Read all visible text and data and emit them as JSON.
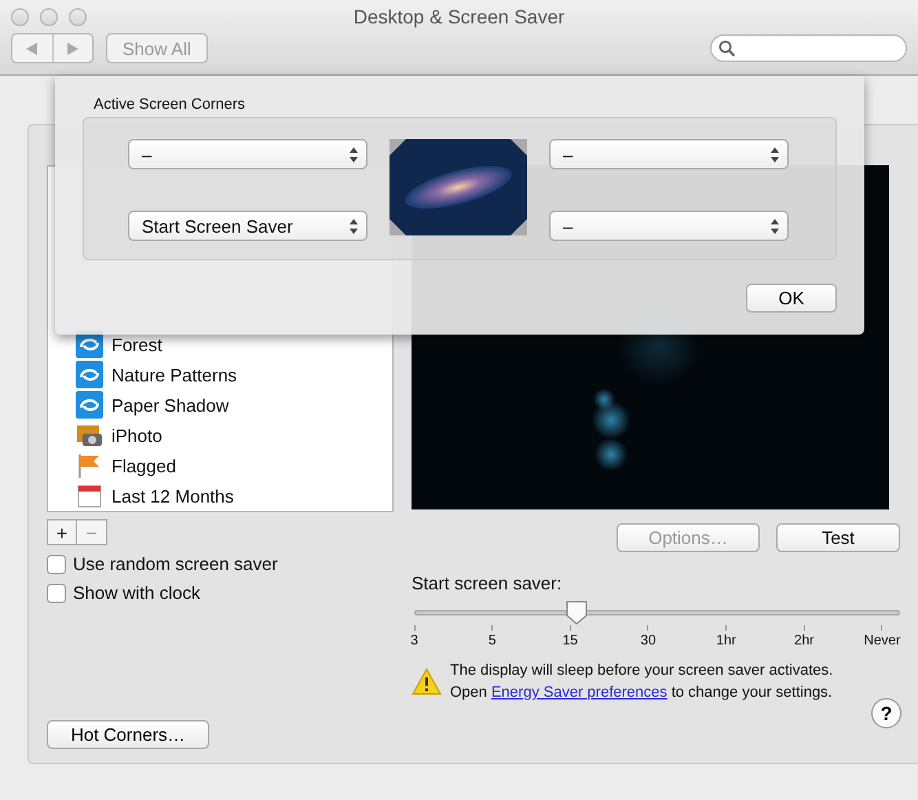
{
  "window": {
    "title": "Desktop & Screen Saver"
  },
  "toolbar": {
    "show_all": "Show All"
  },
  "screen_savers": [
    {
      "label": "Forest",
      "kind": "saver"
    },
    {
      "label": "Nature Patterns",
      "kind": "saver"
    },
    {
      "label": "Paper Shadow",
      "kind": "saver"
    },
    {
      "label": "iPhoto",
      "kind": "camera"
    },
    {
      "label": "Flagged",
      "kind": "flag"
    },
    {
      "label": "Last 12 Months",
      "kind": "calendar"
    }
  ],
  "list_buttons": [
    "+",
    "−"
  ],
  "options": [
    {
      "label": "Use random screen saver",
      "checked": false
    },
    {
      "label": "Show with clock",
      "checked": false
    }
  ],
  "hot_corners_button": "Hot Corners…",
  "preview_buttons": [
    {
      "label": "Options…",
      "disabled": true
    },
    {
      "label": "Test",
      "disabled": false
    }
  ],
  "start_slider": {
    "label": "Start screen saver:",
    "level": 0.333,
    "ticks": [
      "3",
      "5",
      "15",
      "30",
      "1hr",
      "2hr",
      "Never"
    ]
  },
  "warning": {
    "line1": "The display will sleep before your screen saver activates.",
    "prefix": "Open ",
    "link": "Energy Saver preferences",
    "suffix": " to change your settings."
  },
  "help": "?",
  "sheet": {
    "title": "Active Screen Corners",
    "corners": [
      "–",
      "–",
      "Start Screen Saver",
      "–"
    ],
    "ok": "OK"
  }
}
